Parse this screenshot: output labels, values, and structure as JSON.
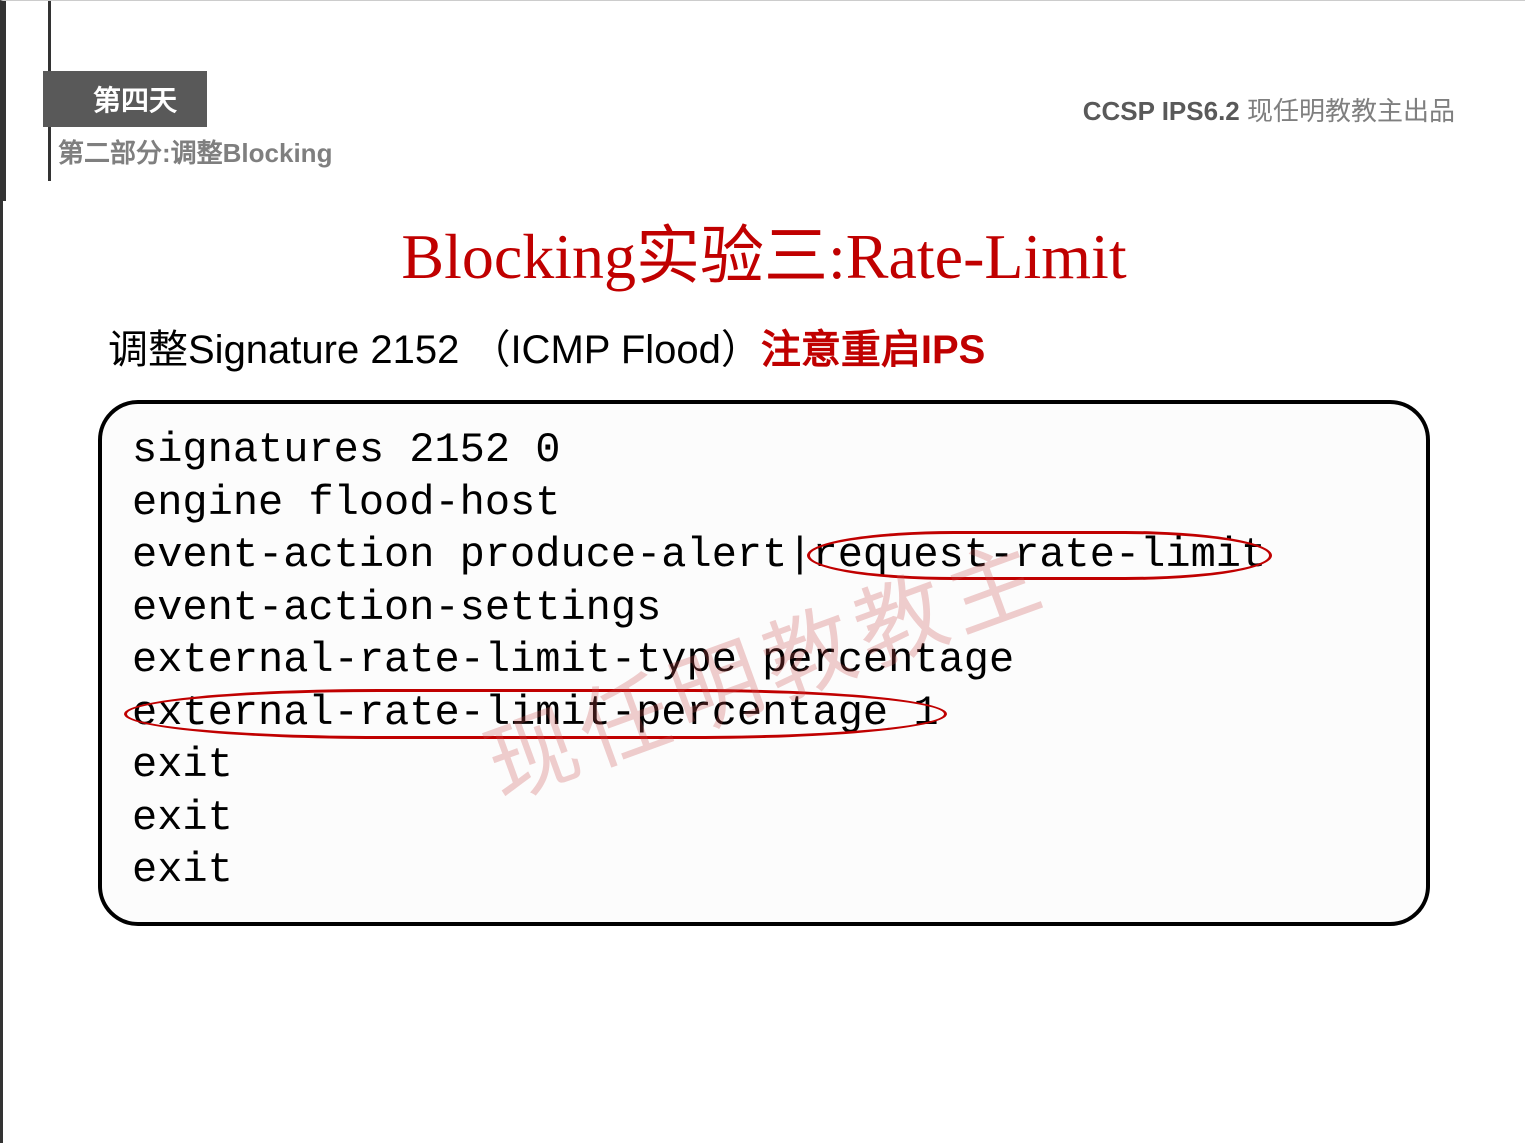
{
  "header": {
    "day": "第四天",
    "section": "第二部分:调整Blocking",
    "course_code": "CCSP IPS6.2",
    "author": " 现任明教教主出品"
  },
  "title": "Blocking实验三:Rate-Limit",
  "subtitle": {
    "prefix": "调整Signature 2152 （ICMP Flood）",
    "emphasis": "注意重启IPS"
  },
  "code": {
    "line1": "signatures 2152 0",
    "line2": "engine flood-host",
    "line3_a": "event-action produce-alert|",
    "line3_b": "request-rate-limit",
    "line4": "event-action-settings",
    "line5": "external-rate-limit-type percentage",
    "line6": "external-rate-limit-percentage 1",
    "line7": "exit",
    "line8": "exit",
    "line9": "exit"
  },
  "watermark": "现任明教教主"
}
